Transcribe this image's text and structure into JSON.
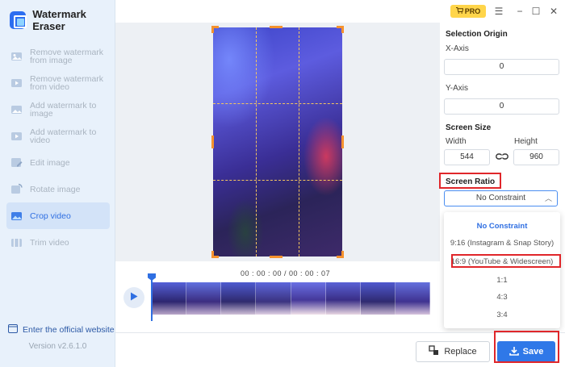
{
  "app": {
    "title": "Watermark Eraser",
    "version": "Version v2.6.1.0",
    "website_link": "Enter the official website"
  },
  "titlebar": {
    "pro_label": "PRO"
  },
  "sidebar": {
    "items": [
      {
        "label": "Remove watermark from image",
        "icon": "eraser-image-icon",
        "active": false
      },
      {
        "label": "Remove watermark from video",
        "icon": "eraser-video-icon",
        "active": false
      },
      {
        "label": "Add watermark to image",
        "icon": "add-image-icon",
        "active": false
      },
      {
        "label": "Add watermark to video",
        "icon": "add-video-icon",
        "active": false
      },
      {
        "label": "Edit image",
        "icon": "edit-image-icon",
        "active": false
      },
      {
        "label": "Rotate image",
        "icon": "rotate-image-icon",
        "active": false
      },
      {
        "label": "Crop video",
        "icon": "crop-video-icon",
        "active": true
      },
      {
        "label": "Trim video",
        "icon": "trim-video-icon",
        "active": false
      }
    ]
  },
  "player": {
    "time": "00 : 00 : 00 / 00 : 00 : 07"
  },
  "panel": {
    "selection_origin": "Selection Origin",
    "x_label": "X-Axis",
    "x_value": "0",
    "y_label": "Y-Axis",
    "y_value": "0",
    "screen_size": "Screen Size",
    "width_label": "Width",
    "width_value": "544",
    "height_label": "Height",
    "height_value": "960",
    "screen_ratio": "Screen Ratio",
    "ratio_selected": "No Constraint",
    "ratio_options": [
      "No Constraint",
      "9:16 (Instagram & Snap Story)",
      "16:9 (YouTube & Widescreen)",
      "1:1",
      "4:3",
      "3:4"
    ]
  },
  "footer": {
    "replace_label": "Replace",
    "save_label": "Save"
  },
  "colors": {
    "accent": "#2f78e8",
    "highlight": "#e0262a",
    "crop_handle": "#f5922e",
    "pro": "#ffd54a"
  }
}
